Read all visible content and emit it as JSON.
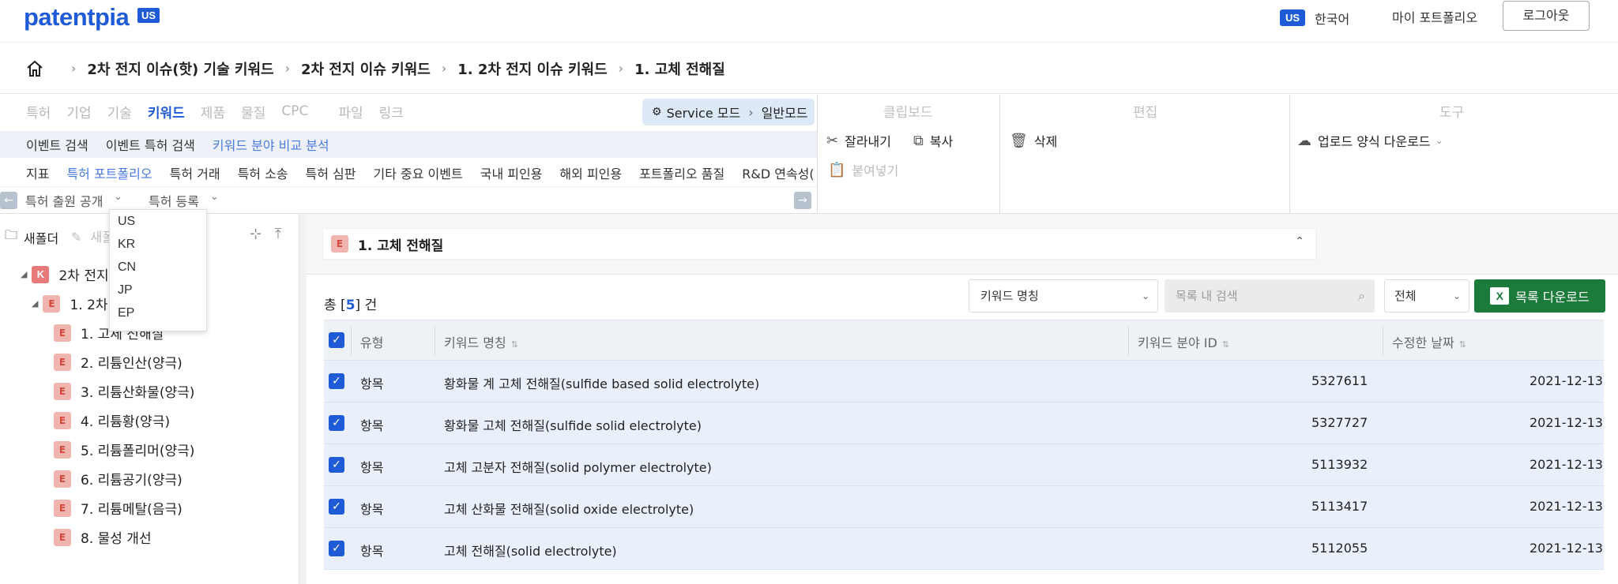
{
  "header": {
    "logo": "patentpia",
    "logo_badge": "US",
    "lang_badge": "US",
    "lang_label": "한국어",
    "my_portfolio": "마이 포트폴리오",
    "logout": "로그아웃"
  },
  "breadcrumb": [
    "2차 전지 이슈(핫) 기술 키워드",
    "2차 전지 이슈 키워드",
    "1. 2차 전지 이슈 키워드",
    "1. 고체 전해질"
  ],
  "tabs": {
    "row1": [
      "특허",
      "기업",
      "기술",
      "키워드",
      "제품",
      "물질",
      "CPC",
      "파일",
      "링크"
    ],
    "row1_active": "키워드",
    "service_mode": "Service 모드",
    "general_mode": "일반모드",
    "row2": [
      "이벤트 검색",
      "이벤트 특허 검색",
      "키워드 분야 비교 분석"
    ],
    "row3": [
      "지표",
      "특허 포트폴리오",
      "특허 거래",
      "특허 소송",
      "특허 심판",
      "기타 중요 이벤트",
      "국내 피인용",
      "해외 피인용",
      "포트폴리오 품질",
      "R&D 연속성("
    ],
    "row4_filter1": "특허 출원 공개",
    "row4_filter2": "특허 등록"
  },
  "panels": {
    "clipboard_title": "클립보드",
    "cut": "잘라내기",
    "copy": "복사",
    "paste": "붙여넣기",
    "edit_title": "편집",
    "delete": "삭제",
    "tools_title": "도구",
    "upload_template": "업로드 양식 다운로드"
  },
  "left": {
    "new_folder": "새폴더",
    "new_edit": "새폴"
  },
  "dropdown_options": [
    "US",
    "KR",
    "CN",
    "JP",
    "EP"
  ],
  "tree": {
    "root_badge": "K",
    "root": "2차 전지",
    "child_badge": "E",
    "child": "1. 2차",
    "items": [
      "1. 고체 전해질",
      "2. 리튬인산(양극)",
      "3. 리튬산화물(양극)",
      "4. 리튬황(양극)",
      "5. 리튬폴리머(양극)",
      "6. 리튬공기(양극)",
      "7. 리튬메탈(음극)",
      "8. 물성 개선"
    ],
    "item_badge": "E"
  },
  "main": {
    "card_title": "1. 고체 전해질",
    "total_prefix": "총 [",
    "total_count": "5",
    "total_suffix": "] 건",
    "select_field": "키워드 명칭",
    "search_placeholder": "목록 내 검색",
    "select_scope": "전체",
    "download_label": "목록 다운로드",
    "columns": [
      "유형",
      "키워드 명칭",
      "키워드 분야 ID",
      "수정한 날짜"
    ],
    "rows": [
      {
        "type": "항목",
        "name": "황화물 계 고체 전해질(sulfide based solid electrolyte)",
        "id": "5327611",
        "date": "2021-12-13"
      },
      {
        "type": "항목",
        "name": "황화물 고체 전해질(sulfide solid electrolyte)",
        "id": "5327727",
        "date": "2021-12-13"
      },
      {
        "type": "항목",
        "name": "고체 고분자 전해질(solid polymer electrolyte)",
        "id": "5113932",
        "date": "2021-12-13"
      },
      {
        "type": "항목",
        "name": "고체 산화물 전해질(solid oxide electrolyte)",
        "id": "5113417",
        "date": "2021-12-13"
      },
      {
        "type": "항목",
        "name": "고체 전해질(solid electrolyte)",
        "id": "5112055",
        "date": "2021-12-13"
      }
    ]
  },
  "colors": {
    "brand": "#1f5bd6",
    "excel": "#1c7a3a",
    "keyword_badge": "#e87a7a"
  }
}
